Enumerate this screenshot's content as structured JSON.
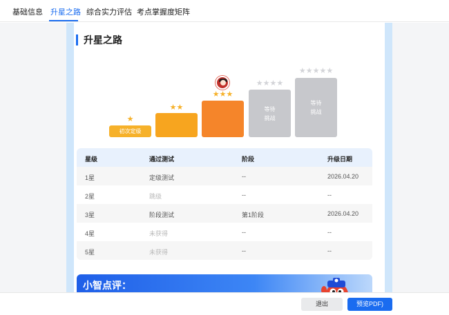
{
  "tabs": [
    {
      "label": "基础信息"
    },
    {
      "label": "升星之路"
    },
    {
      "label": "综合实力评估"
    },
    {
      "label": "考点掌握度矩阵"
    }
  ],
  "active_tab": "升星之路",
  "section": {
    "title": "升星之路"
  },
  "steps": [
    {
      "stars_earned": 1,
      "stars_total": 1,
      "label": "初次定级",
      "color": "#f6b12a"
    },
    {
      "stars_earned": 2,
      "stars_total": 2,
      "label": "",
      "color": "#f7a51f"
    },
    {
      "stars_earned": 3,
      "stars_total": 3,
      "label": "",
      "color": "#f5852a",
      "current": true
    },
    {
      "stars_earned": 0,
      "stars_total": 4,
      "label_line1": "等待",
      "label_line2": "挑战",
      "color": "#c7c8cc"
    },
    {
      "stars_earned": 0,
      "stars_total": 5,
      "label_line1": "等待",
      "label_line2": "挑战",
      "color": "#c7c8cc"
    }
  ],
  "table": {
    "headers": [
      "星级",
      "通过测试",
      "阶段",
      "升级日期"
    ],
    "rows": [
      [
        "1星",
        "定级测试",
        "--",
        "2026.04.20"
      ],
      [
        "2星",
        "跳级",
        "--",
        "--"
      ],
      [
        "3星",
        "阶段测试",
        "第1阶段",
        "2026.04.20"
      ],
      [
        "4星",
        "未获得",
        "--",
        "--"
      ],
      [
        "5星",
        "未获得",
        "--",
        "--"
      ]
    ],
    "muted_cells": [
      [
        1,
        1
      ],
      [
        3,
        1
      ],
      [
        4,
        1
      ]
    ]
  },
  "comment": {
    "title": "小智点评："
  },
  "footer": {
    "exit_label": "退出",
    "pdf_label": "预览PDF)"
  }
}
